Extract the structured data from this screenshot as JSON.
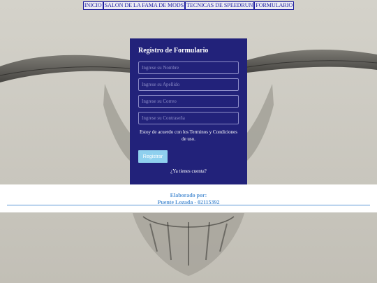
{
  "nav": {
    "items": [
      {
        "label": "INICIO"
      },
      {
        "label": "SALON DE LA FAMA DE MODS"
      },
      {
        "label": "TECNICAS DE SPEEDRUN"
      },
      {
        "label": "FORMULARIO"
      }
    ]
  },
  "form": {
    "title": "Registro de Formulario",
    "name_placeholder": "Ingrese su Nombre",
    "surname_placeholder": "Ingrese su Apellido",
    "email_placeholder": "Ingrese su Correo",
    "password_placeholder": "Ingrese su Contraseña",
    "terms_text": "Estoy de acuerdo con los Terminos y Condiciones de uso.",
    "submit_label": "Registrar",
    "login_link": "¿Ya tienes cuenta?"
  },
  "footer": {
    "line1": "Elaborado por:",
    "line2": "Puente Lozada - 02115392"
  },
  "colors": {
    "card": "#22227a",
    "accent": "#5a97d6",
    "button": "#8fd0ee"
  }
}
